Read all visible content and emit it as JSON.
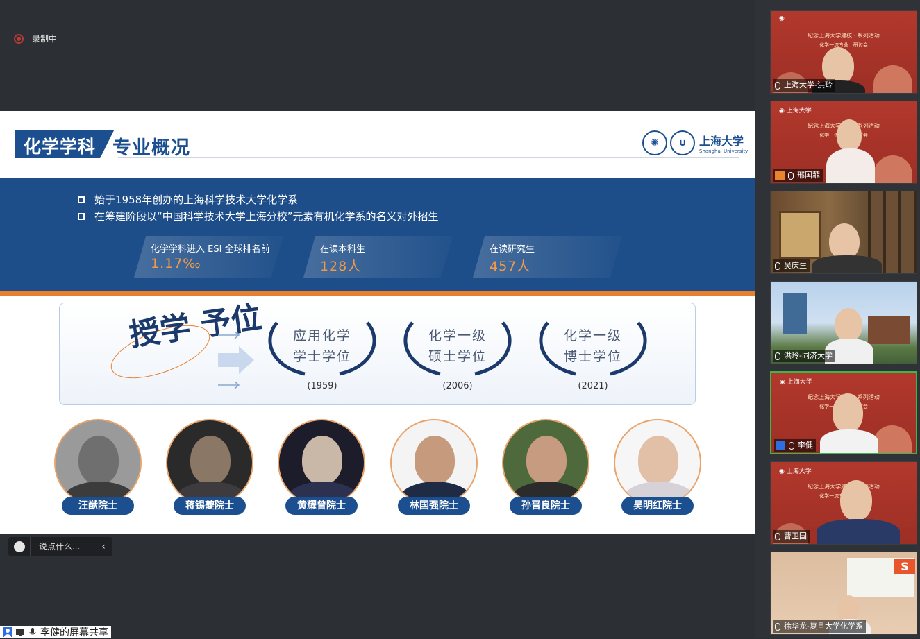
{
  "recording": {
    "label": "录制中"
  },
  "slide": {
    "title_left": "化学学科",
    "title_right": "专业概况",
    "logo_cn": "上海大学",
    "logo_en": "Shanghai University",
    "bullets": [
      "始于1958年创办的上海科学技术大学化学系",
      "在筹建阶段以“中国科学技术大学上海分校”元素有机化学系的名义对外招生"
    ],
    "stats": [
      {
        "label": "化学学科进入 ESI 全球排名前",
        "value": "1.17‰"
      },
      {
        "label": "在读本科生",
        "value": "128人"
      },
      {
        "label": "在读研究生",
        "value": "457人"
      }
    ],
    "degree_title": "授学 予位",
    "degrees": [
      {
        "line1": "应用化学",
        "line2": "学士学位",
        "year": "(1959)"
      },
      {
        "line1": "化学一级",
        "line2": "硕士学位",
        "year": "(2006)"
      },
      {
        "line1": "化学一级",
        "line2": "博士学位",
        "year": "(2021)"
      }
    ],
    "academicians": [
      "汪猷院士",
      "蒋锡夔院士",
      "黄耀曾院士",
      "林国强院士",
      "孙晋良院士",
      "吴明红院士"
    ]
  },
  "chat": {
    "placeholder": "说点什么..."
  },
  "share_bar": {
    "label": "李健的屏幕共享"
  },
  "participants": [
    {
      "name": "上海大学-洪玲"
    },
    {
      "name": "邢国菲"
    },
    {
      "name": "吴庆生"
    },
    {
      "name": "洪玲-同济大学"
    },
    {
      "name": "李健",
      "active": true
    },
    {
      "name": "曹卫国"
    },
    {
      "name": "徐华龙-复旦大学化学系"
    }
  ],
  "event_banner": {
    "line1": "纪念上海大学建校 · 系列活动",
    "line2": "化学一流专业 · 研讨会"
  },
  "colors": {
    "brand_blue": "#1b4f8f",
    "accent_orange": "#e87f2e",
    "active_green": "#3cb84a"
  }
}
